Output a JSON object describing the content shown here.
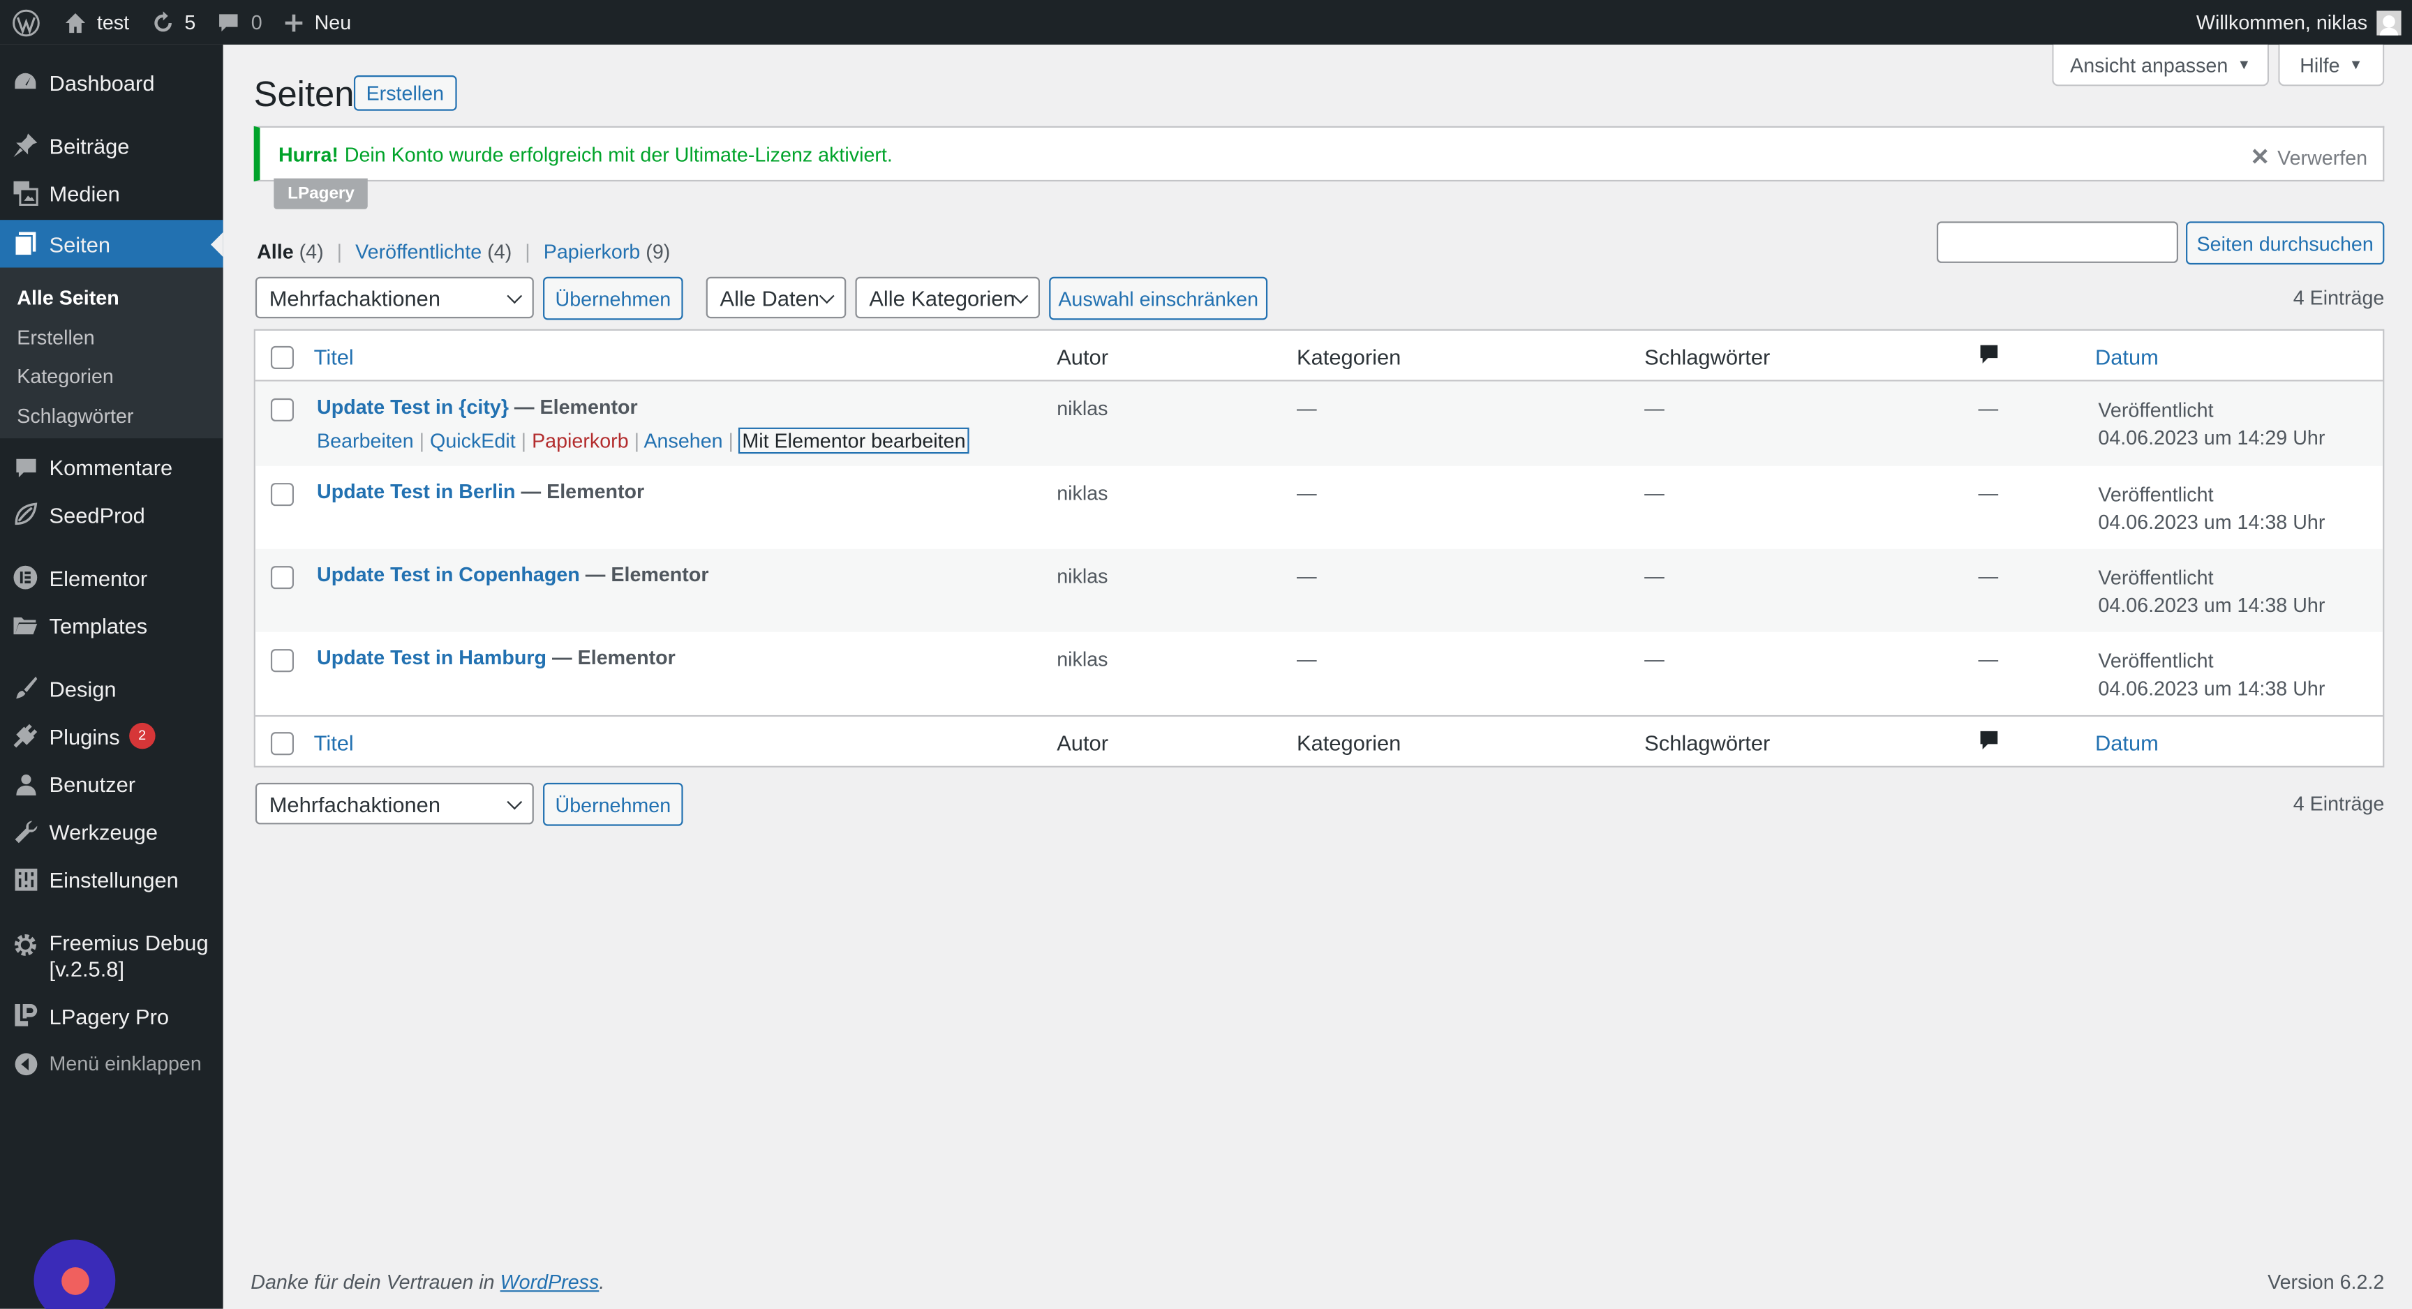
{
  "adminbar": {
    "site_name": "test",
    "updates_count": "5",
    "comments_count": "0",
    "new_label": "Neu",
    "welcome": "Willkommen, niklas"
  },
  "sidebar": {
    "items": [
      {
        "label": "Dashboard",
        "icon": "dashboard-icon"
      },
      {
        "label": "Beiträge",
        "icon": "pin-icon"
      },
      {
        "label": "Medien",
        "icon": "media-icon"
      },
      {
        "label": "Seiten",
        "icon": "pages-icon"
      },
      {
        "label": "Kommentare",
        "icon": "comment-icon"
      },
      {
        "label": "SeedProd",
        "icon": "seedprod-icon"
      },
      {
        "label": "Elementor",
        "icon": "elementor-icon"
      },
      {
        "label": "Templates",
        "icon": "folder-icon"
      },
      {
        "label": "Design",
        "icon": "brush-icon"
      },
      {
        "label": "Plugins",
        "icon": "plugin-icon",
        "badge": "2"
      },
      {
        "label": "Benutzer",
        "icon": "user-icon"
      },
      {
        "label": "Werkzeuge",
        "icon": "wrench-icon"
      },
      {
        "label": "Einstellungen",
        "icon": "settings-icon"
      },
      {
        "label": "Freemius Debug",
        "label2": "[v.2.5.8]",
        "icon": "gear-icon"
      },
      {
        "label": "LPagery Pro",
        "icon": "lpagery-icon"
      },
      {
        "label": "Menü einklappen",
        "icon": "collapse-icon"
      }
    ],
    "submenu": [
      "Alle Seiten",
      "Erstellen",
      "Kategorien",
      "Schlagwörter"
    ]
  },
  "screen_meta": {
    "screen_options": "Ansicht anpassen",
    "help": "Hilfe"
  },
  "page": {
    "title": "Seiten",
    "add_new": "Erstellen"
  },
  "notice": {
    "strong": "Hurra!",
    "text": "Dein Konto wurde erfolgreich mit der Ultimate-Lizenz aktiviert.",
    "dismiss": "Verwerfen",
    "tag": "LPagery"
  },
  "views": {
    "all": "Alle",
    "all_count": "(4)",
    "published": "Veröffentlichte",
    "published_count": "(4)",
    "trash": "Papierkorb",
    "trash_count": "(9)"
  },
  "search": {
    "value": "",
    "button": "Seiten durchsuchen"
  },
  "toolbar": {
    "bulk_actions": "Mehrfachaktionen",
    "apply": "Übernehmen",
    "all_dates": "Alle Daten",
    "all_categories": "Alle Kategorien",
    "filter": "Auswahl einschränken",
    "items_count": "4 Einträge"
  },
  "table": {
    "columns": {
      "title": "Titel",
      "author": "Autor",
      "categories": "Kategorien",
      "tags": "Schlagwörter",
      "date": "Datum"
    },
    "rows": [
      {
        "title": "Update Test in {city}",
        "state": " — Elementor",
        "author": "niklas",
        "categories": "—",
        "tags": "—",
        "comments": "—",
        "status": "Veröffentlicht",
        "date": "04.06.2023 um 14:29 Uhr"
      },
      {
        "title": "Update Test in Berlin",
        "state": " — Elementor",
        "author": "niklas",
        "categories": "—",
        "tags": "—",
        "comments": "—",
        "status": "Veröffentlicht",
        "date": "04.06.2023 um 14:38 Uhr"
      },
      {
        "title": "Update Test in Copenhagen",
        "state": " — Elementor",
        "author": "niklas",
        "categories": "—",
        "tags": "—",
        "comments": "—",
        "status": "Veröffentlicht",
        "date": "04.06.2023 um 14:38 Uhr"
      },
      {
        "title": "Update Test in Hamburg",
        "state": " — Elementor",
        "author": "niklas",
        "categories": "—",
        "tags": "—",
        "comments": "—",
        "status": "Veröffentlicht",
        "date": "04.06.2023 um 14:38 Uhr"
      }
    ],
    "row_actions": {
      "edit": "Bearbeiten",
      "quickedit": "QuickEdit",
      "trash": "Papierkorb",
      "view": "Ansehen",
      "elementor": "Mit Elementor bearbeiten"
    }
  },
  "footer": {
    "thanks": "Danke für dein Vertrauen in ",
    "wp_link": "WordPress",
    "period": ".",
    "version": "Version 6.2.2"
  }
}
